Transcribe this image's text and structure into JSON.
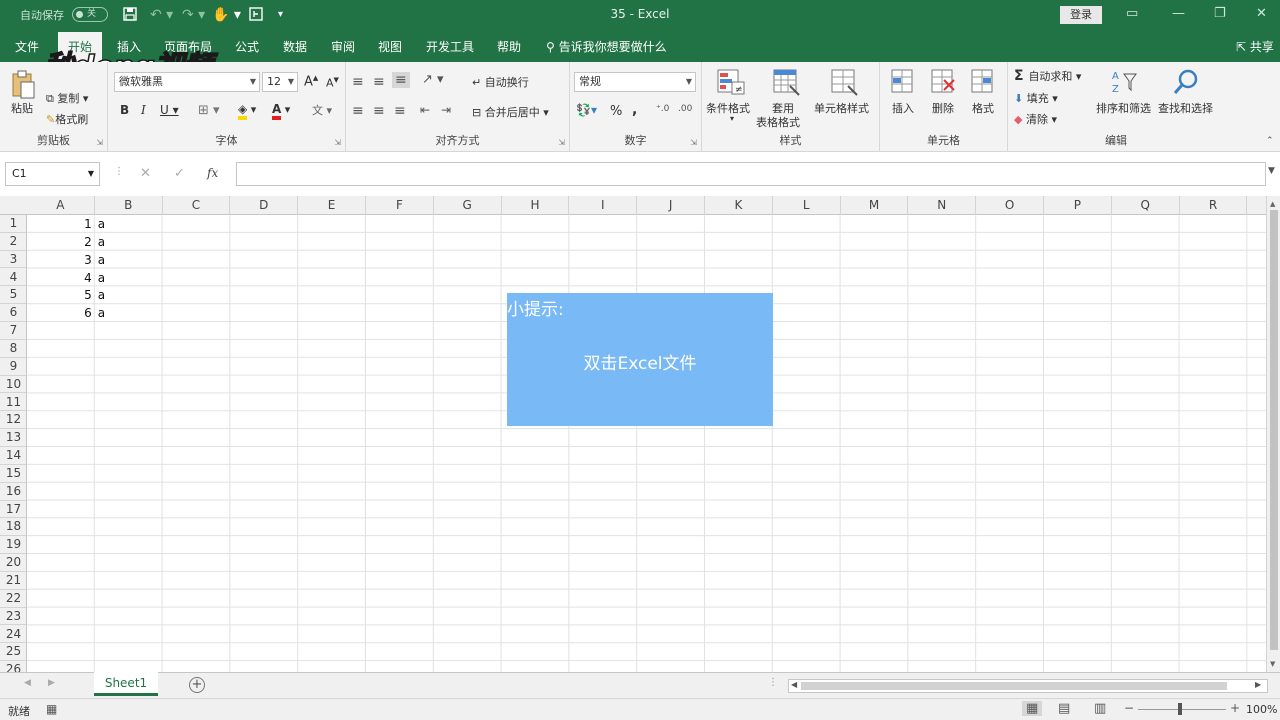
{
  "titlebar": {
    "autosave_label": "自动保存",
    "autosave_state": "关",
    "doc_title": "35  -  Excel",
    "login_label": "登录"
  },
  "menu": {
    "tabs": [
      "文件",
      "开始",
      "插入",
      "页面布局",
      "公式",
      "数据",
      "审阅",
      "视图",
      "开发工具",
      "帮助"
    ],
    "active_tab": "开始",
    "tell_me": "告诉我你想要做什么",
    "share": "共享"
  },
  "ribbon": {
    "clipboard": {
      "paste": "粘贴",
      "copy": "复制",
      "format_painter": "格式刷",
      "label": "剪贴板"
    },
    "font": {
      "font_name": "微软雅黑",
      "font_size": "12",
      "label": "字体"
    },
    "alignment": {
      "wrap_text": "自动换行",
      "merge_center": "合并后居中",
      "label": "对齐方式"
    },
    "number": {
      "format": "常规",
      "percent": "%",
      "comma": ",",
      "label": "数字"
    },
    "styles": {
      "conditional": "条件格式",
      "table_l1": "套用",
      "table_l2": "表格格式",
      "cell_styles": "单元格样式",
      "label": "样式"
    },
    "cells": {
      "insert": "插入",
      "delete": "删除",
      "format": "格式",
      "label": "单元格"
    },
    "editing": {
      "autosum": "自动求和",
      "fill": "填充",
      "clear": "清除",
      "sort": "排序和筛选",
      "find": "查找和选择",
      "label": "编辑"
    }
  },
  "watermark": "秒dong视频",
  "formula_bar": {
    "name_box": "C1",
    "fx": "fx",
    "value": ""
  },
  "columns": [
    "A",
    "B",
    "C",
    "D",
    "E",
    "F",
    "G",
    "H",
    "I",
    "J",
    "K",
    "L",
    "M",
    "N",
    "O",
    "P",
    "Q",
    "R"
  ],
  "rows": [
    "1",
    "2",
    "3",
    "4",
    "5",
    "6",
    "7",
    "8",
    "9",
    "10",
    "11",
    "12",
    "13",
    "14",
    "15",
    "16",
    "17",
    "18",
    "19",
    "20",
    "21",
    "22",
    "23",
    "24",
    "25",
    "26"
  ],
  "cells": {
    "A": [
      "1",
      "2",
      "3",
      "4",
      "5",
      "6"
    ],
    "B": [
      "a",
      "a",
      "a",
      "a",
      "a",
      "a"
    ]
  },
  "tip": {
    "title": "小提示:",
    "body": "双击Excel文件"
  },
  "sheet_tabs": [
    "Sheet1"
  ],
  "status": {
    "ready": "就绪",
    "zoom": "100%"
  }
}
